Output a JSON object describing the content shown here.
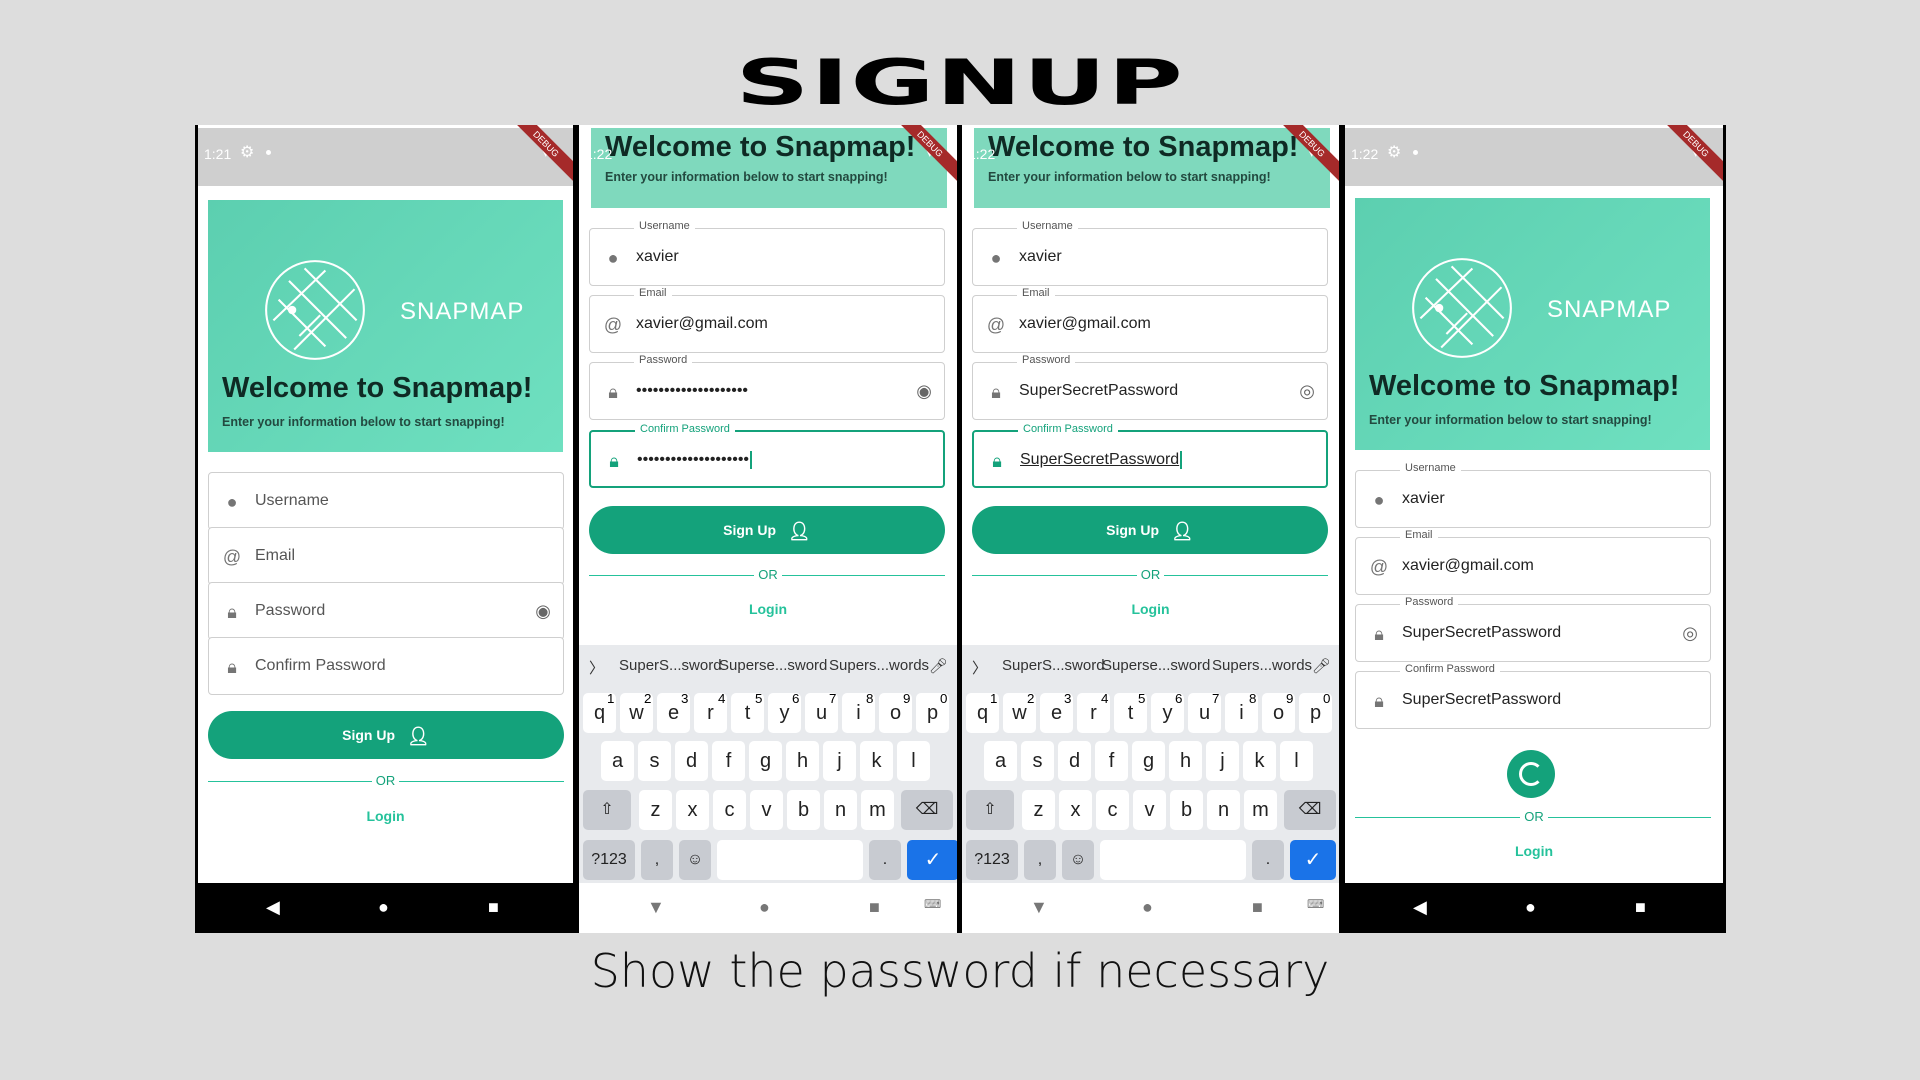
{
  "title": "SIGNUP",
  "caption": "Show the password if necessary",
  "brand": "SNAPMAP",
  "welcome": "Welcome to Snapmap!",
  "subtitle": "Enter your information below to start snapping!",
  "status": {
    "time1": "1:21",
    "time2": "1:22",
    "debug": "DEBUG"
  },
  "labels": {
    "username": "Username",
    "email": "Email",
    "password": "Password",
    "confirm": "Confirm Password"
  },
  "values": {
    "username": "xavier",
    "email": "xavier@gmail.com",
    "password_masked": "••••••••••••••••••••",
    "password": "SuperSecretPassword"
  },
  "buttons": {
    "signup": "Sign Up",
    "or": "OR",
    "login": "Login"
  },
  "keyboard": {
    "suggestions": [
      "SuperS...sword",
      "Superse...sword",
      "Supers...words"
    ],
    "row1": [
      "q",
      "w",
      "e",
      "r",
      "t",
      "y",
      "u",
      "i",
      "o",
      "p"
    ],
    "row1_nums": [
      "1",
      "2",
      "3",
      "4",
      "5",
      "6",
      "7",
      "8",
      "9",
      "0"
    ],
    "row2": [
      "a",
      "s",
      "d",
      "f",
      "g",
      "h",
      "j",
      "k",
      "l"
    ],
    "row3": [
      "z",
      "x",
      "c",
      "v",
      "b",
      "n",
      "m"
    ],
    "sym": "?123",
    "comma": ",",
    "period": "."
  },
  "colors": {
    "accent": "#14a27b",
    "hero": "#6fe0c0",
    "background": "#dddddd"
  }
}
